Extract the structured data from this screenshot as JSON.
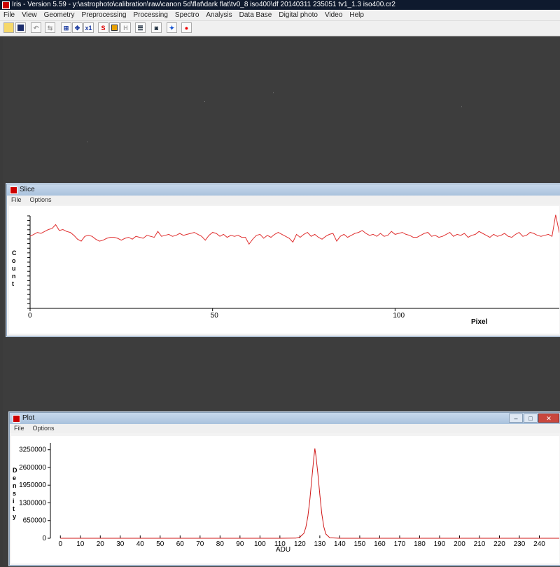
{
  "app": {
    "title": "Iris - Version 5.59 - y:\\astrophoto\\calibration\\raw\\canon 5d\\flat\\dark flat\\tv0_8 iso400\\df 20140311 235051 tv1_1.3 iso400.cr2",
    "menu": [
      "File",
      "View",
      "Geometry",
      "Preprocessing",
      "Processing",
      "Spectro",
      "Analysis",
      "Data Base",
      "Digital photo",
      "Video",
      "Help"
    ]
  },
  "toolbar": {
    "icons": [
      "open-folder-icon",
      "save-disk-icon",
      "undo-icon",
      "swap-icon",
      "zoom-fit-icon",
      "pan-icon",
      "zoom-x1-icon",
      "sigma-icon",
      "box-icon",
      "histogram-icon",
      "list-icon",
      "camera-icon",
      "star-blue-icon",
      "record-red-icon"
    ],
    "zoom_label": "x1",
    "sigma_label": "S"
  },
  "slice_window": {
    "title": "Slice",
    "menu": [
      "File",
      "Options"
    ],
    "ylabel": "Count",
    "xlabel": "Pixel",
    "line_color": "#e03030"
  },
  "plot_window": {
    "title": "Plot",
    "menu": [
      "File",
      "Options"
    ],
    "ylabel": "Density",
    "xlabel": "ADU",
    "controls": {
      "minimize": "–",
      "maximize": "□",
      "close": "✕"
    },
    "line_color": "#d01818"
  },
  "chart_data": [
    {
      "type": "line",
      "title": "",
      "xlabel": "Pixel",
      "ylabel": "Count",
      "xticks": [
        0,
        50,
        100
      ],
      "xlim": [
        0,
        145
      ],
      "ylim": [
        40,
        135
      ],
      "grid": false,
      "series": [
        {
          "values": [
            114,
            116,
            118,
            117,
            119,
            121,
            122,
            126,
            120,
            121,
            119,
            118,
            115,
            111,
            109,
            114,
            115,
            114,
            111,
            109,
            110,
            112,
            113,
            113,
            112,
            110,
            112,
            113,
            111,
            114,
            113,
            112,
            115,
            114,
            113,
            119,
            114,
            115,
            116,
            114,
            115,
            117,
            115,
            116,
            117,
            118,
            116,
            114,
            110,
            115,
            118,
            117,
            114,
            116,
            113,
            115,
            114,
            115,
            113,
            113,
            106,
            111,
            115,
            116,
            112,
            115,
            113,
            116,
            118,
            116,
            114,
            112,
            108,
            116,
            113,
            116,
            118,
            114,
            116,
            113,
            111,
            114,
            116,
            117,
            109,
            114,
            116,
            113,
            115,
            117,
            118,
            120,
            117,
            115,
            116,
            114,
            117,
            114,
            115,
            119,
            116,
            117,
            118,
            116,
            115,
            113,
            113,
            115,
            117,
            118,
            114,
            115,
            113,
            114,
            116,
            118,
            114,
            116,
            115,
            117,
            113,
            115,
            116,
            119,
            117,
            115,
            113,
            116,
            114,
            115,
            117,
            114,
            113,
            116,
            118,
            114,
            115,
            118,
            117,
            115,
            114,
            115,
            116,
            114,
            136,
            118,
            114
          ]
        }
      ]
    },
    {
      "type": "line",
      "title": "",
      "xlabel": "ADU",
      "ylabel": "Density",
      "xticks": [
        0,
        10,
        20,
        30,
        40,
        50,
        60,
        70,
        80,
        90,
        100,
        110,
        120,
        130,
        140,
        150,
        160,
        170,
        180,
        190,
        200,
        210,
        220,
        230,
        240
      ],
      "yticks": [
        0,
        650000,
        1300000,
        1950000,
        2600000,
        3250000
      ],
      "xlim": [
        -5,
        250
      ],
      "ylim": [
        0,
        3500000
      ],
      "grid": false,
      "peak": {
        "x": 127.5,
        "y": 3300000,
        "sigma": 2.3
      },
      "series": [
        {
          "x": [
            0,
            110,
            118,
            120,
            122,
            123,
            124,
            125,
            126,
            127,
            127.5,
            128,
            129,
            130,
            131,
            132,
            133,
            135,
            140,
            250
          ],
          "values": [
            0,
            0,
            5000,
            40000,
            180000,
            400000,
            800000,
            1400000,
            2200000,
            2950000,
            3300000,
            3050000,
            2400000,
            1600000,
            900000,
            420000,
            160000,
            20000,
            0,
            0
          ]
        }
      ]
    }
  ]
}
